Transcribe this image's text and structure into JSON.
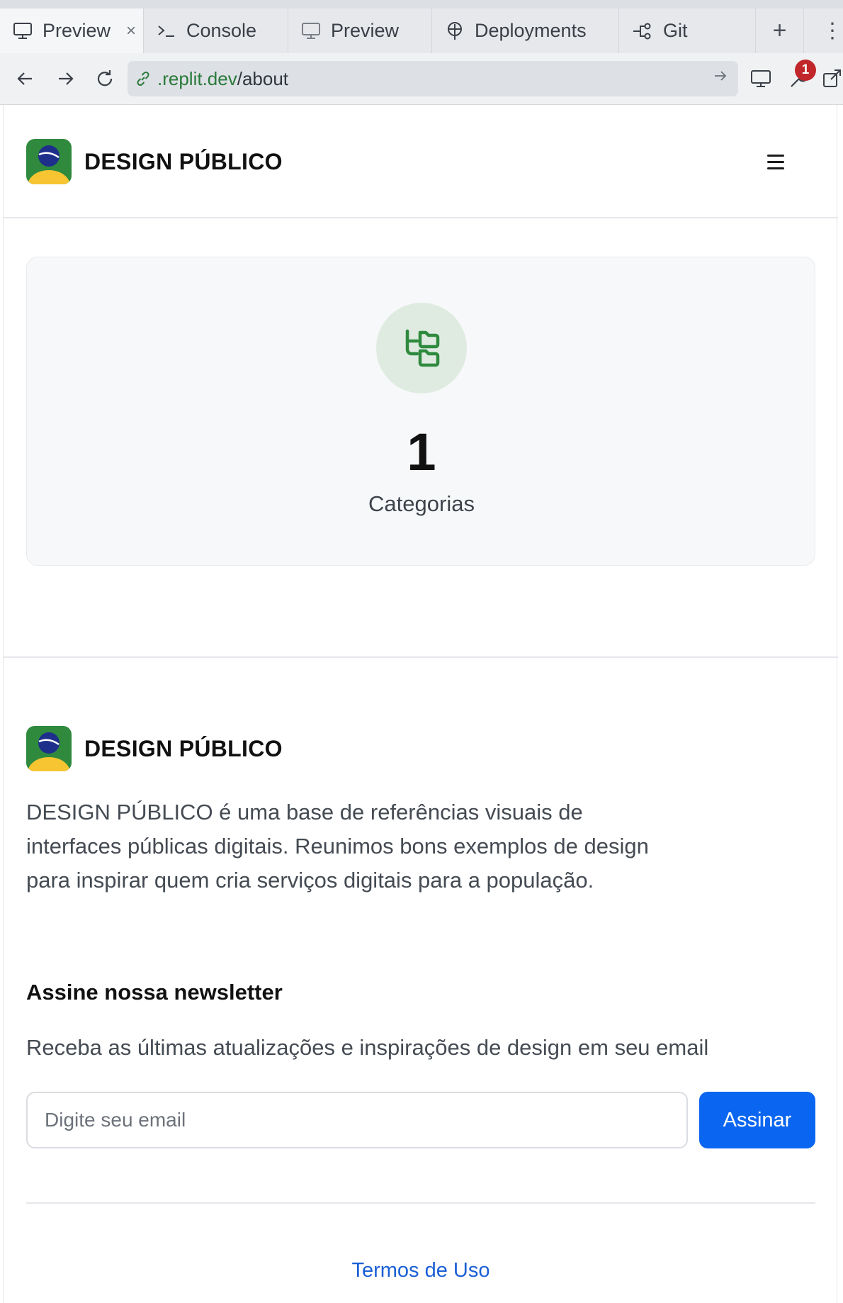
{
  "browser": {
    "tabs": [
      {
        "label": "Preview",
        "icon": "monitor-icon",
        "active": true
      },
      {
        "label": "Console",
        "icon": "terminal-icon"
      },
      {
        "label": "Preview",
        "icon": "monitor-icon"
      },
      {
        "label": "Deployments",
        "icon": "deploy-icon"
      },
      {
        "label": "Git",
        "icon": "git-icon"
      }
    ],
    "close_glyph": "×",
    "new_tab_glyph": "+",
    "more_glyph": "⋮",
    "url_host": ".replit.dev",
    "url_path": "/about",
    "devtools_badge": "1"
  },
  "site": {
    "brand_bold": "DESIGN",
    "brand_rest": "PÚBLICO"
  },
  "stats": {
    "value": "1",
    "label": "Categorias",
    "icon": "folder-tree-icon"
  },
  "footer": {
    "brand_bold": "DESIGN",
    "brand_rest": "PÚBLICO",
    "description": "DESIGN PÚBLICO é uma base de referências visuais de interfaces públicas digitais. Reunimos bons exemplos de design para inspirar quem cria serviços digitais para a população.",
    "newsletter_title": "Assine nossa newsletter",
    "newsletter_subtitle": "Receba as últimas atualizações e inspirações de design em seu email",
    "email_placeholder": "Digite seu email",
    "subscribe_label": "Assinar",
    "terms_label": "Termos de Uso"
  },
  "colors": {
    "accent_button": "#0a66f0",
    "link": "#1a5fd6",
    "logo_green": "#2f8a3e",
    "logo_blue": "#1d2f8a",
    "logo_yellow": "#f7c531",
    "icon_green": "#2f8a3e"
  }
}
